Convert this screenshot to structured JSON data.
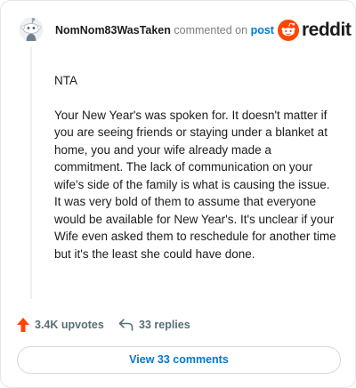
{
  "header": {
    "username": "NomNom83WasTaken",
    "action_text": "commented on",
    "post_link": "post",
    "brand": "reddit"
  },
  "comment": {
    "paragraphs": [
      "NTA",
      "Your New Year's was spoken for. It doesn't matter if you are seeing friends or staying under a blanket at home, you and your wife already made a commitment. The lack of communication on your wife's side of the family is what is causing the issue. It was very bold of them to assume that everyone would be available for New Year's. It's unclear if your Wife even asked them to reschedule for another time but it's the least she could have done."
    ]
  },
  "actions": {
    "upvotes": "3.4K upvotes",
    "replies": "33 replies"
  },
  "view_comments": "View 33 comments",
  "colors": {
    "brand_orange": "#ff4500",
    "link_blue": "#0079d3",
    "text": "#1c1c1c",
    "muted": "#576f76"
  },
  "icons": {
    "avatar": "snoo-avatar-icon",
    "logo": "reddit-logo-icon",
    "upvote": "upvote-arrow-icon",
    "reply": "reply-arrow-icon"
  }
}
